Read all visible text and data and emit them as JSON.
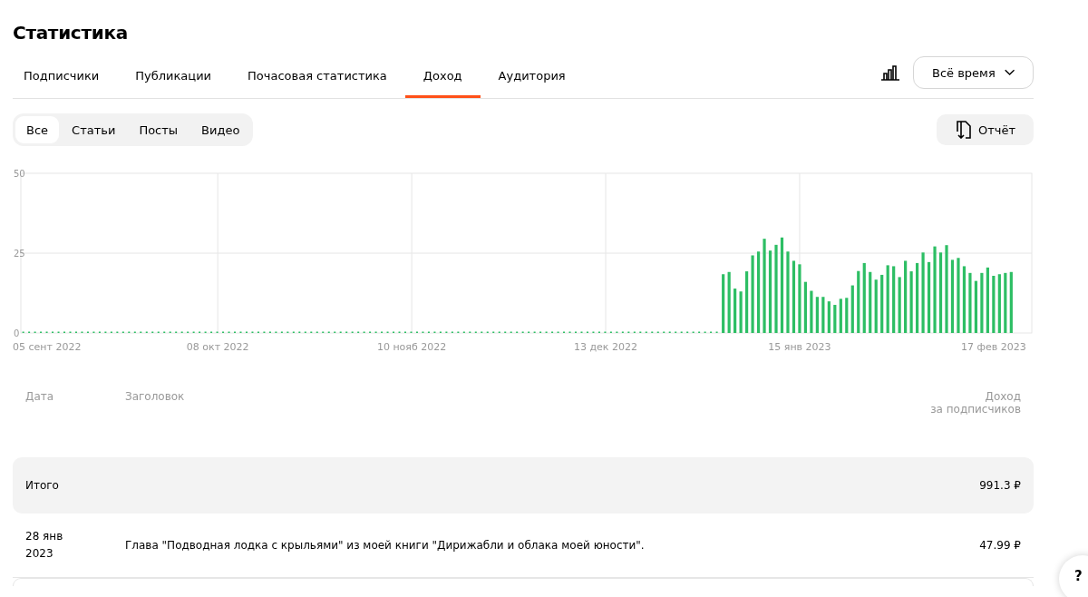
{
  "page_title": "Статистика",
  "tabs": [
    {
      "label": "Подписчики",
      "selected": false
    },
    {
      "label": "Публикации",
      "selected": false
    },
    {
      "label": "Почасовая статистика",
      "selected": false
    },
    {
      "label": "Доход",
      "selected": true
    },
    {
      "label": "Аудитория",
      "selected": false
    }
  ],
  "period_dropdown": {
    "value": "Всё время"
  },
  "filters": [
    {
      "label": "Все",
      "selected": true
    },
    {
      "label": "Статьи",
      "selected": false
    },
    {
      "label": "Посты",
      "selected": false
    },
    {
      "label": "Видео",
      "selected": false
    }
  ],
  "report_button": "Отчёт",
  "chart_data": {
    "type": "bar",
    "ylim": [
      0,
      50
    ],
    "yticks": [
      0,
      25,
      50
    ],
    "categories": [
      "05 сент 2022",
      null,
      null,
      null,
      null,
      null,
      null,
      null,
      null,
      null,
      null,
      null,
      null,
      null,
      null,
      null,
      null,
      null,
      null,
      null,
      null,
      null,
      null,
      null,
      null,
      null,
      null,
      null,
      null,
      null,
      null,
      null,
      null,
      "08 окт 2022",
      null,
      null,
      null,
      null,
      null,
      null,
      null,
      null,
      null,
      null,
      null,
      null,
      null,
      null,
      null,
      null,
      null,
      null,
      null,
      null,
      null,
      null,
      null,
      null,
      null,
      null,
      null,
      null,
      null,
      null,
      null,
      null,
      "10 нояб 2022",
      null,
      null,
      null,
      null,
      null,
      null,
      null,
      null,
      null,
      null,
      null,
      null,
      null,
      null,
      null,
      null,
      null,
      null,
      null,
      null,
      null,
      null,
      null,
      null,
      null,
      null,
      null,
      null,
      null,
      null,
      null,
      null,
      "13 дек 2022",
      null,
      null,
      null,
      null,
      null,
      null,
      null,
      null,
      null,
      null,
      null,
      null,
      null,
      null,
      null,
      null,
      null,
      null,
      null,
      null,
      null,
      null,
      null,
      null,
      null,
      null,
      null,
      null,
      null,
      null,
      null,
      null,
      "15 янв 2023",
      null,
      null,
      null,
      null,
      null,
      null,
      null,
      null,
      null,
      null,
      null,
      null,
      null,
      null,
      null,
      null,
      null,
      null,
      null,
      null,
      null,
      null,
      null,
      null,
      null,
      null,
      null,
      null,
      null,
      null,
      null,
      null,
      "17 фев 2023",
      null,
      null,
      null,
      null,
      null,
      null
    ],
    "series": [
      {
        "color": "#2dbe64",
        "values": [
          0,
          0,
          0,
          0,
          0,
          0,
          0,
          0,
          0,
          0,
          0,
          0,
          0,
          0,
          0,
          0,
          0,
          0,
          0,
          0,
          0,
          0,
          0,
          0,
          0,
          0,
          0,
          0,
          0,
          0,
          0,
          0,
          0,
          0,
          0,
          0,
          0,
          0,
          0,
          0,
          0,
          0,
          0,
          0,
          0,
          0,
          0,
          0,
          0,
          0,
          0,
          0,
          0,
          0,
          0,
          0,
          0,
          0,
          0,
          0,
          0,
          0,
          0,
          0,
          0,
          0,
          0,
          0,
          0,
          0,
          0,
          0,
          0,
          0,
          0,
          0,
          0,
          0,
          0,
          0,
          0,
          0,
          0,
          0,
          0,
          0,
          0,
          0,
          0,
          0,
          0,
          0,
          0,
          0,
          0,
          0,
          0,
          0,
          0,
          0,
          0,
          0,
          0,
          0,
          0,
          0,
          0,
          0,
          0,
          0,
          0,
          0,
          0,
          0,
          0,
          0,
          0,
          0,
          0,
          18.4,
          19.1,
          13.9,
          13,
          19.3,
          24.3,
          25.5,
          29.5,
          25.8,
          27.6,
          29.9,
          25.5,
          22.6,
          21.5,
          16,
          13.2,
          11.3,
          11.3,
          9.9,
          8.8,
          10.7,
          11,
          14.9,
          19.4,
          21.9,
          19.1,
          16.7,
          18.2,
          21.2,
          20.9,
          17.5,
          22.6,
          19.3,
          21.9,
          25.2,
          22.2,
          27.1,
          25.2,
          27.5,
          22.9,
          23.5,
          20.9,
          18.8,
          16.3,
          18.8,
          20.5,
          17.9,
          18.4,
          18.8,
          19.1,
          null,
          null,
          null
        ]
      }
    ]
  },
  "table": {
    "columns": [
      {
        "label": "Дата"
      },
      {
        "label": "Заголовок"
      },
      {
        "label": "Доход\nза подписчиков"
      }
    ],
    "total": {
      "label": "Итого",
      "value": "991.3 ₽"
    },
    "rows": [
      {
        "date": "28 янв\n2023",
        "title": "Глава \"Подводная лодка с крыльями\" из моей книги \"Дирижабли и облака моей юности\".",
        "income": "47.99 ₽"
      }
    ]
  },
  "help_button": "?"
}
